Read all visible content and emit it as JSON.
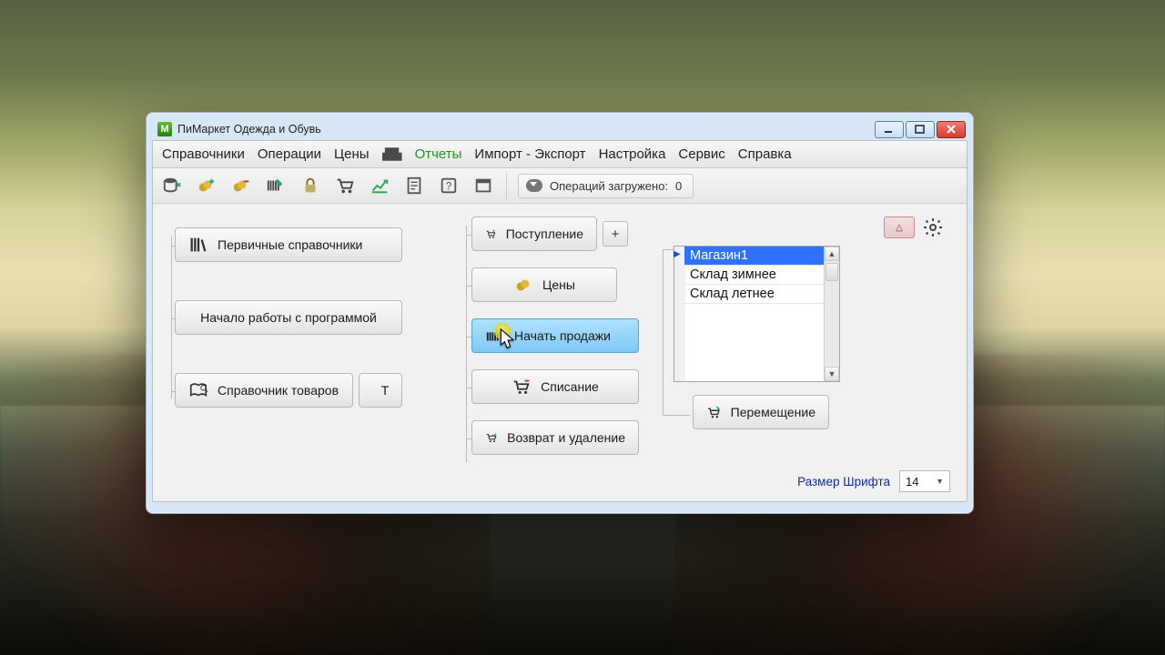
{
  "window": {
    "title": "ПиMаркет Одежда и Обувь"
  },
  "menu": {
    "items": [
      "Справочники",
      "Операции",
      "Цены"
    ],
    "print_icon": "print-icon",
    "reports": "Отчеты",
    "rest": [
      "Импорт - Экспорт",
      "Настройка",
      "Сервис",
      "Справка"
    ]
  },
  "toolbar": {
    "icons": [
      "db-icon",
      "coins-plus-icon",
      "coins-minus-icon",
      "barcode-edit-icon",
      "lock-icon",
      "cart-icon",
      "chart-up-icon",
      "document-icon",
      "help-icon",
      "window-icon"
    ],
    "status_label": "Операций загружено:",
    "status_count": "0"
  },
  "left": {
    "primary_refs": "Первичные справочники",
    "getting_started": "Начало работы с программой",
    "goods_ref": "Справочник товаров",
    "t_button": "Т"
  },
  "center": {
    "receipt": "Поступление",
    "plus": "+",
    "prices": "Цены",
    "start_sales": "Начать продажи",
    "writeoff": "Списание",
    "return_delete": "Возврат и удаление"
  },
  "right": {
    "warn_icon": "warning-icon",
    "gear_icon": "gear-icon",
    "list": [
      "Магазин1",
      "Склад зимнее",
      "Склад летнее"
    ],
    "selected_index": 0,
    "move": "Перемещение"
  },
  "footer": {
    "font_label": "Размер Шрифта",
    "font_value": "14"
  }
}
